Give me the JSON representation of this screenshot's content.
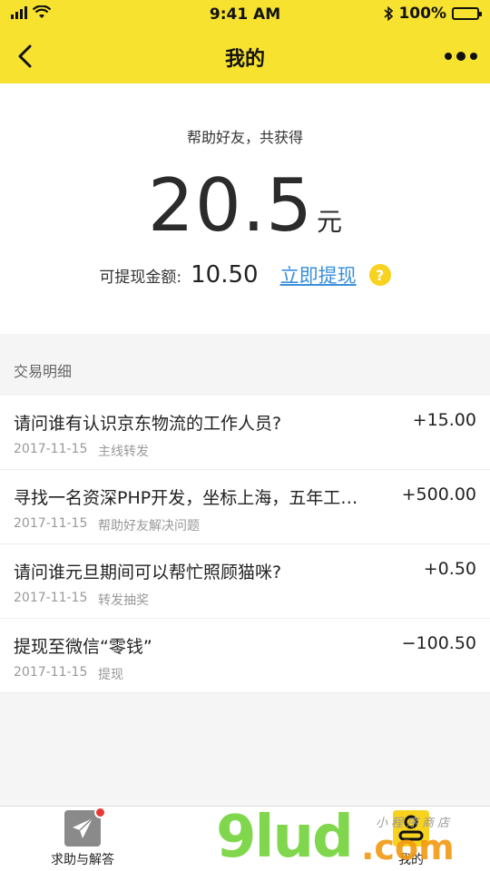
{
  "status_bar": {
    "time": "9:41 AM",
    "battery": "100%"
  },
  "header": {
    "title": "我的"
  },
  "summary": {
    "subtitle": "帮助好友，共获得",
    "amount": "20.5",
    "unit": "元",
    "withdrawable_label": "可提现金额:",
    "withdrawable_value": "10.50",
    "withdraw_link": "立即提现",
    "help_icon": "?"
  },
  "transactions": {
    "section_title": "交易明细",
    "items": [
      {
        "title": "请问谁有认识京东物流的工作人员?",
        "amount": "+15.00",
        "date": "2017-11-15",
        "type": "主线转发"
      },
      {
        "title": "寻找一名资深PHP开发，坐标上海，五年工…",
        "amount": "+500.00",
        "date": "2017-11-15",
        "type": "帮助好友解决问题"
      },
      {
        "title": "请问谁元旦期间可以帮忙照顾猫咪?",
        "amount": "+0.50",
        "date": "2017-11-15",
        "type": "转发抽奖"
      },
      {
        "title": "提现至微信“零钱”",
        "amount": "−100.50",
        "date": "2017-11-15",
        "type": "提现"
      }
    ]
  },
  "tabbar": {
    "help_label": "求助与解答",
    "me_label": "我的"
  },
  "watermark": {
    "big": "9lud",
    "suffix": ".com",
    "cn": "小程序商店"
  },
  "colors": {
    "brand_yellow": "#f7e230",
    "link_blue": "#3a8fdc",
    "badge_red": "#e53935"
  }
}
